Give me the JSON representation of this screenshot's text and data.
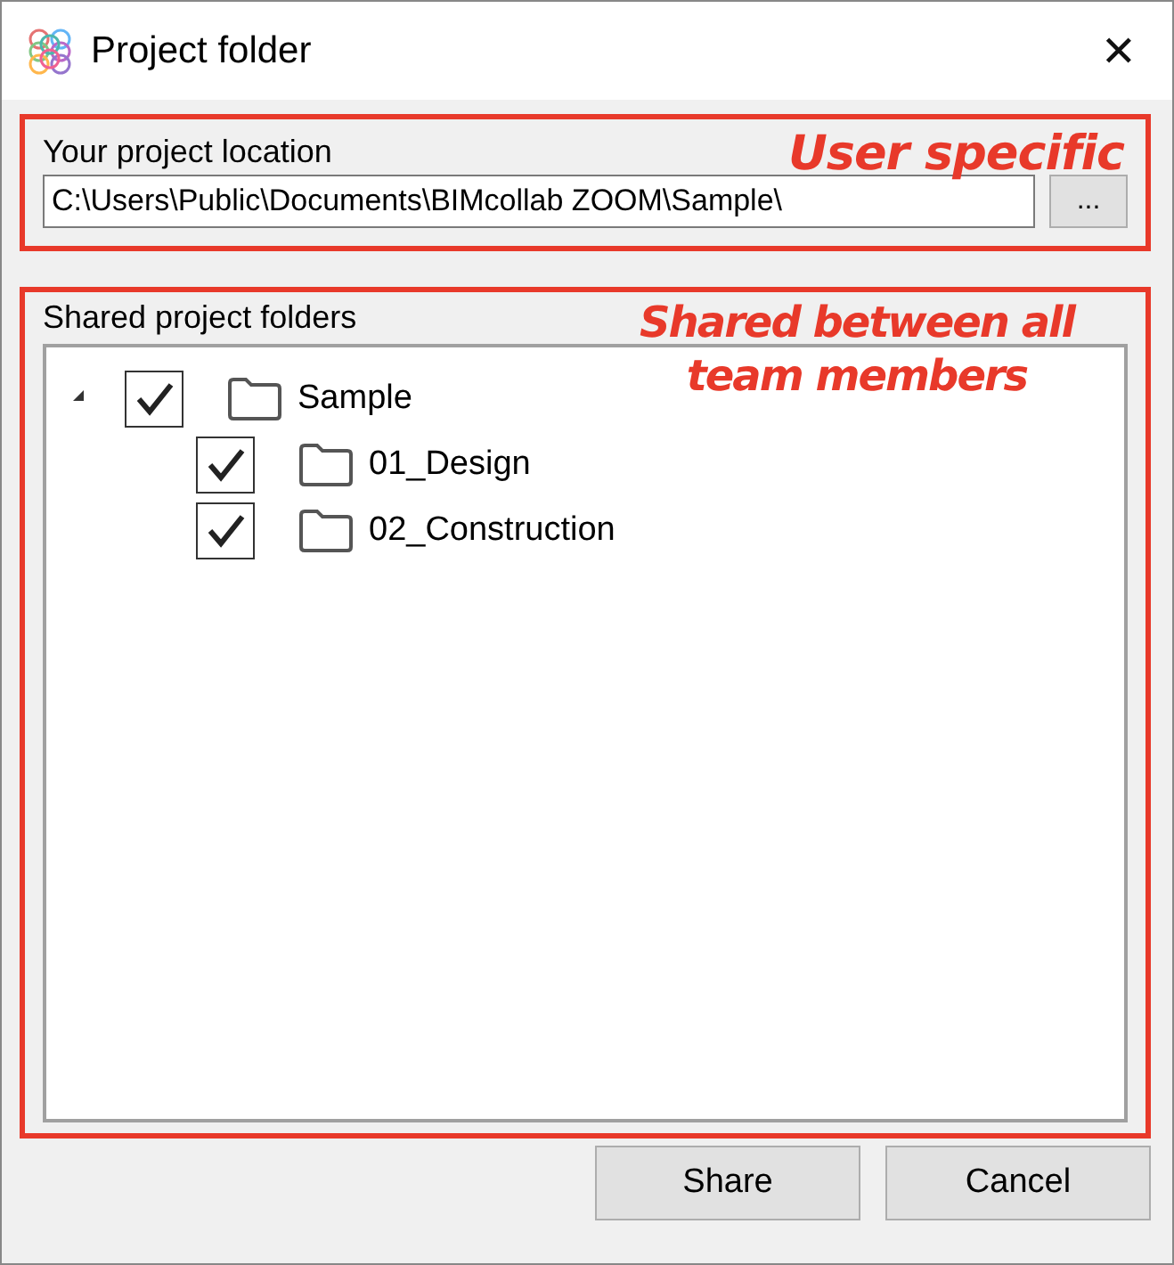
{
  "window": {
    "title": "Project folder",
    "close": "✕"
  },
  "location": {
    "label": "Your project location",
    "value": "C:\\Users\\Public\\Documents\\BIMcollab ZOOM\\Sample\\",
    "browse": "...",
    "annotation": "User specific"
  },
  "shared": {
    "label": "Shared project folders",
    "annotation": "Shared between all team members",
    "tree": [
      {
        "name": "Sample",
        "checked": true,
        "expanded": true,
        "children": [
          {
            "name": "01_Design",
            "checked": true
          },
          {
            "name": "02_Construction",
            "checked": true
          }
        ]
      }
    ]
  },
  "buttons": [
    "Share",
    "Cancel"
  ]
}
